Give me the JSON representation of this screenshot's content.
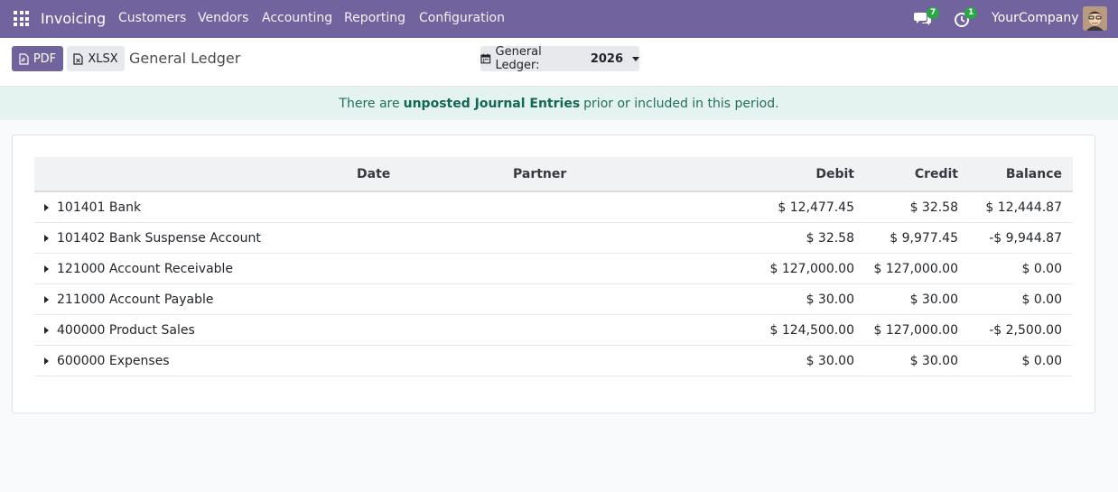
{
  "navbar": {
    "app_name": "Invoicing",
    "menus": [
      "Customers",
      "Vendors",
      "Accounting",
      "Reporting",
      "Configuration"
    ],
    "messages_badge": "7",
    "activities_badge": "1",
    "company": "YourCompany",
    "bg_color": "#71639e"
  },
  "control_panel": {
    "pdf_label": "PDF",
    "xlsx_label": "XLSX",
    "title": "General Ledger",
    "filter_label": "General Ledger:",
    "filter_value": "2026"
  },
  "alert": {
    "prefix": "There are",
    "link_text": "unposted Journal Entries",
    "suffix": "prior or included in this period."
  },
  "table": {
    "headers": {
      "date": "Date",
      "partner": "Partner",
      "debit": "Debit",
      "credit": "Credit",
      "balance": "Balance"
    },
    "rows": [
      {
        "account": "101401 Bank",
        "debit": "$ 12,477.45",
        "credit": "$ 32.58",
        "balance": "$ 12,444.87"
      },
      {
        "account": "101402 Bank Suspense Account",
        "debit": "$ 32.58",
        "credit": "$ 9,977.45",
        "balance": "-$ 9,944.87"
      },
      {
        "account": "121000 Account Receivable",
        "debit": "$ 127,000.00",
        "credit": "$ 127,000.00",
        "balance": "$ 0.00"
      },
      {
        "account": "211000 Account Payable",
        "debit": "$ 30.00",
        "credit": "$ 30.00",
        "balance": "$ 0.00"
      },
      {
        "account": "400000 Product Sales",
        "debit": "$ 124,500.00",
        "credit": "$ 127,000.00",
        "balance": "-$ 2,500.00"
      },
      {
        "account": "600000 Expenses",
        "debit": "$ 30.00",
        "credit": "$ 30.00",
        "balance": "$ 0.00"
      }
    ]
  }
}
